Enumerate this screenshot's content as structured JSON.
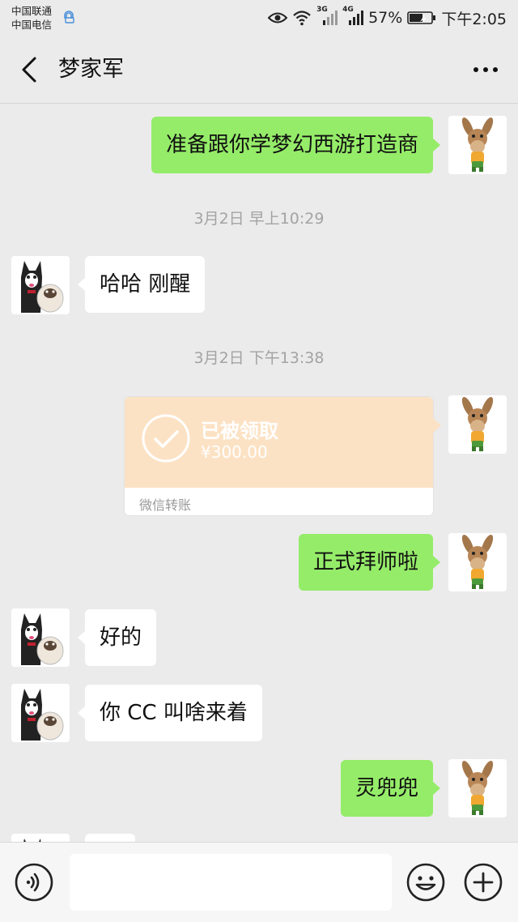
{
  "status_bar": {
    "carrier_1": "中国联通",
    "carrier_2": "中国电信",
    "network_3g": "3G",
    "network_4g": "4G",
    "battery": "57%",
    "time": "下午2:05"
  },
  "header": {
    "title": "梦家军"
  },
  "messages": {
    "m1": {
      "text": "准备跟你学梦幻西游打造商"
    },
    "ts1": "3月2日 早上10:29",
    "m2": {
      "text": "哈哈 刚醒"
    },
    "ts2": "3月2日 下午13:38",
    "transfer": {
      "status": "已被领取",
      "amount": "¥300.00",
      "source": "微信转账"
    },
    "m3": {
      "text": "正式拜师啦"
    },
    "m4": {
      "text": "好的"
    },
    "m5": {
      "text": "你 CC 叫啥来着"
    },
    "m6": {
      "text": "灵兜兜"
    }
  },
  "input_bar": {
    "value": "",
    "voice_icon": "voice-icon",
    "emoji_icon": "emoji-icon",
    "plus_icon": "plus-icon"
  },
  "colors": {
    "sent_bubble": "#95ec69",
    "received_bubble": "#ffffff",
    "transfer_card": "#fce2c4",
    "background": "#ebebeb"
  }
}
